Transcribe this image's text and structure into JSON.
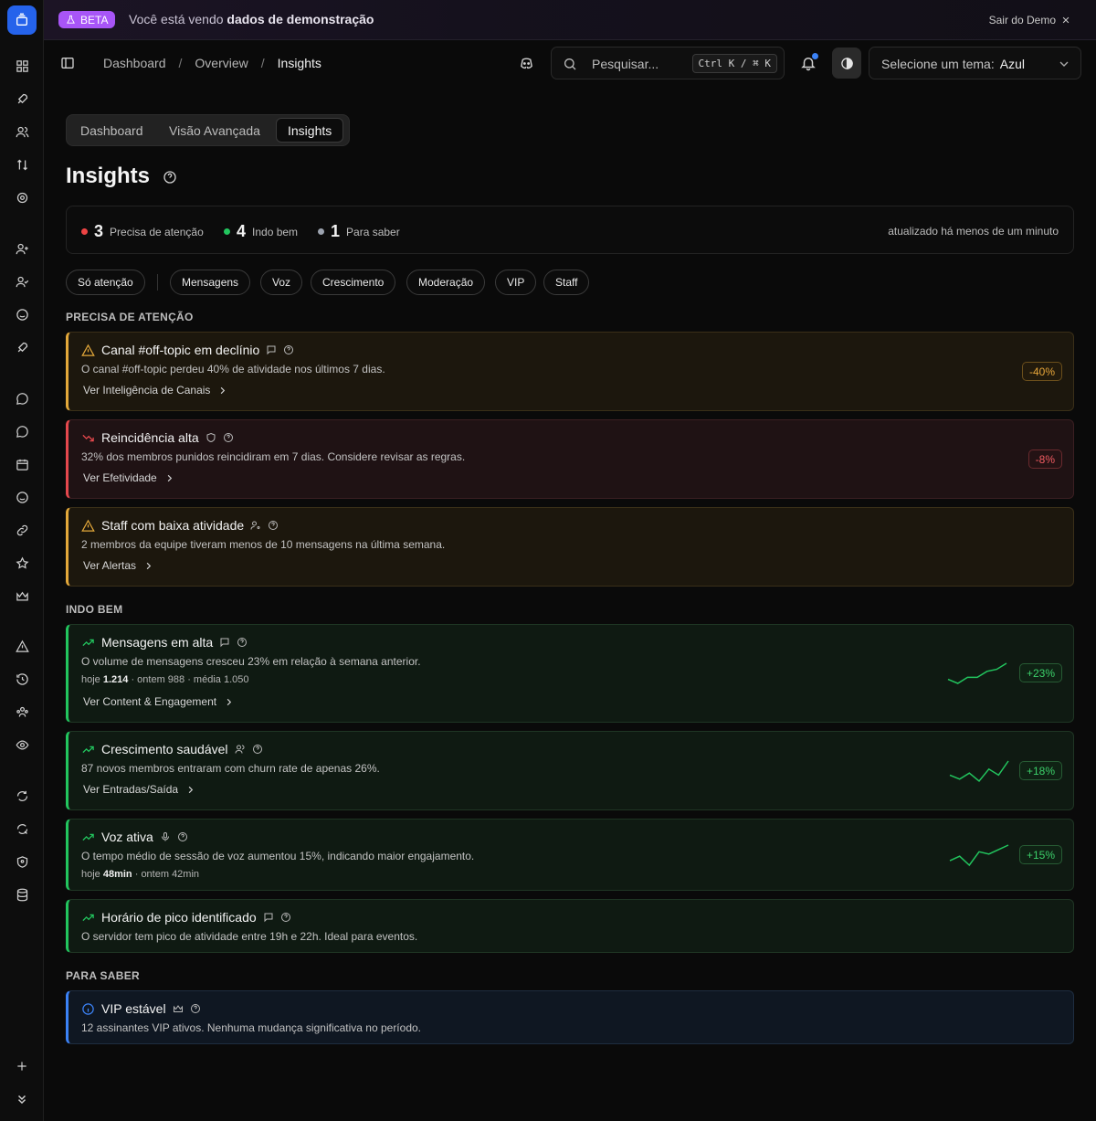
{
  "banner": {
    "beta": "BETA",
    "text_prefix": "Você está vendo",
    "text_bold": "dados de demonstração",
    "exit": "Sair do Demo"
  },
  "header": {
    "breadcrumbs": [
      "Dashboard",
      "Overview",
      "Insights"
    ],
    "search_placeholder": "Pesquisar...",
    "search_shortcut": "Ctrl K / ⌘ K",
    "theme_label": "Selecione um tema:",
    "theme_value": "Azul"
  },
  "tabs": [
    "Dashboard",
    "Visão Avançada",
    "Insights"
  ],
  "page": {
    "title": "Insights"
  },
  "summary": {
    "items": [
      {
        "count": "3",
        "label": "Precisa de atenção",
        "color": "#ef4444"
      },
      {
        "count": "4",
        "label": "Indo bem",
        "color": "#22c55e"
      },
      {
        "count": "1",
        "label": "Para saber",
        "color": "#9ca3af"
      }
    ],
    "updated": "atualizado há menos de um minuto"
  },
  "filters": [
    "Só atenção",
    "Mensagens",
    "Voz",
    "Crescimento",
    "Moderação",
    "VIP",
    "Staff"
  ],
  "sections": {
    "attention": "PRECISA DE ATENÇÃO",
    "good": "INDO BEM",
    "info": "PARA SABER"
  },
  "cards": {
    "c1": {
      "title": "Canal #off-topic em declínio",
      "desc": "O canal #off-topic perdeu 40% de atividade nos últimos 7 dias.",
      "link": "Ver Inteligência de Canais",
      "badge": "-40%"
    },
    "c2": {
      "title": "Reincidência alta",
      "desc": "32% dos membros punidos reincidiram em 7 dias. Considere revisar as regras.",
      "link": "Ver Efetividade",
      "badge": "-8%"
    },
    "c3": {
      "title": "Staff com baixa atividade",
      "desc": "2 membros da equipe tiveram menos de 10 mensagens na última semana.",
      "link": "Ver Alertas"
    },
    "c4": {
      "title": "Mensagens em alta",
      "desc": "O volume de mensagens cresceu 23% em relação à semana anterior.",
      "meta_hoje": "hoje",
      "meta_hoje_val": "1.214",
      "meta_rest": "· ontem 988 · média 1.050",
      "link": "Ver Content & Engagement",
      "badge": "+23%",
      "spark": [
        2,
        0,
        3,
        3,
        6,
        7,
        10
      ]
    },
    "c5": {
      "title": "Crescimento saudável",
      "desc": "87 novos membros entraram com churn rate de apenas 26%.",
      "link": "Ver Entradas/Saída",
      "badge": "+18%",
      "spark": [
        3,
        1,
        4,
        0,
        6,
        3,
        10
      ]
    },
    "c6": {
      "title": "Voz ativa",
      "desc": "O tempo médio de sessão de voz aumentou 15%, indicando maior engajamento.",
      "meta_hoje": "hoje",
      "meta_hoje_val": "48min",
      "meta_rest": "· ontem 42min",
      "badge": "+15%",
      "spark": [
        3,
        5,
        1,
        7,
        6,
        8,
        10
      ]
    },
    "c7": {
      "title": "Horário de pico identificado",
      "desc": "O servidor tem pico de atividade entre 19h e 22h. Ideal para eventos."
    },
    "c8": {
      "title": "VIP estável",
      "desc": "12 assinantes VIP ativos. Nenhuma mudança significativa no período."
    }
  }
}
